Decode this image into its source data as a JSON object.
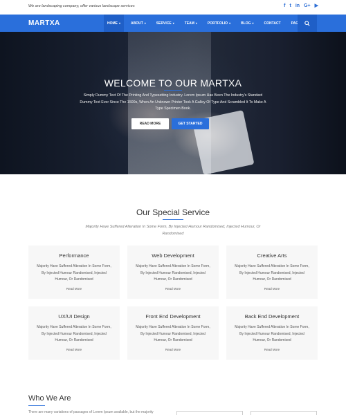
{
  "topbar": {
    "tagline": "We are landscaping company, offer various landscape services",
    "social": [
      {
        "icon": "facebook-icon",
        "glyph": "f"
      },
      {
        "icon": "twitter-icon",
        "glyph": "t"
      },
      {
        "icon": "linkedin-icon",
        "glyph": "in"
      },
      {
        "icon": "google-plus-icon",
        "glyph": "G+"
      },
      {
        "icon": "youtube-icon",
        "glyph": "▶"
      }
    ]
  },
  "nav": {
    "logo": "MARTXA",
    "items": [
      {
        "label": "HOME",
        "caret": "▾"
      },
      {
        "label": "ABOUT",
        "caret": "▾"
      },
      {
        "label": "SERVICE",
        "caret": "▾"
      },
      {
        "label": "TEAM",
        "caret": "▾"
      },
      {
        "label": "PORTFOLIO",
        "caret": "▾"
      },
      {
        "label": "BLOG",
        "caret": "▾"
      },
      {
        "label": "CONTACT",
        "caret": ""
      },
      {
        "label": "PAGES",
        "caret": "▾"
      }
    ],
    "search_icon": "search-icon"
  },
  "hero": {
    "title": "WELCOME TO OUR MARTXA",
    "subtitle": "Simply Dummy Text Of The Printing And Typesetting Industry. Lorem Ipsum Has Been The Industry's Standard Dummy Text Ever Since The 1500s, When An Unknown Printer Took A Galley Of Type And Scrambled It To Make A Type Specimen Book.",
    "read_more": "READ MORE",
    "get_started": "GET STARTED"
  },
  "services": {
    "title": "Our Special Service",
    "subtitle": "Majority Have Suffered Alteration In Some Form, By Injected Humour Randomised, Injected Humour, Or Randomised",
    "cards": [
      {
        "title": "Performance",
        "desc": "Majority Have Suffered Alteration In Some Form, By Injected Humour Randomised, Injected Humour, Or Randomised",
        "more": "Read More"
      },
      {
        "title": "Web Development",
        "desc": "Majority Have Suffered Alteration In Some Form, By Injected Humour Randomised, Injected Humour, Or Randomised",
        "more": "Read More"
      },
      {
        "title": "Creative Arts",
        "desc": "Majority Have Suffered Alteration In Some Form, By Injected Humour Randomised, Injected Humour, Or Randomised",
        "more": "Read More"
      },
      {
        "title": "UX/UI Design",
        "desc": "Majority Have Suffered Alteration In Some Form, By Injected Humour Randomised, Injected Humour, Or Randomised",
        "more": "Read More"
      },
      {
        "title": "Front End Development",
        "desc": "Majority Have Suffered Alteration In Some Form, By Injected Humour Randomised, Injected Humour, Or Randomised",
        "more": "Read More"
      },
      {
        "title": "Back End Development",
        "desc": "Majority Have Suffered Alteration In Some Form, By Injected Humour Randomised, Injected Humour, Or Randomised",
        "more": "Read More"
      }
    ]
  },
  "who": {
    "title": "Who We Are",
    "text": "There are many variations of passages of Lorem Ipsum available, but the majority"
  },
  "colors": {
    "accent": "#2a6fdb",
    "nav_active": "#1f5fc7",
    "card_bg": "#f7f7f7"
  }
}
